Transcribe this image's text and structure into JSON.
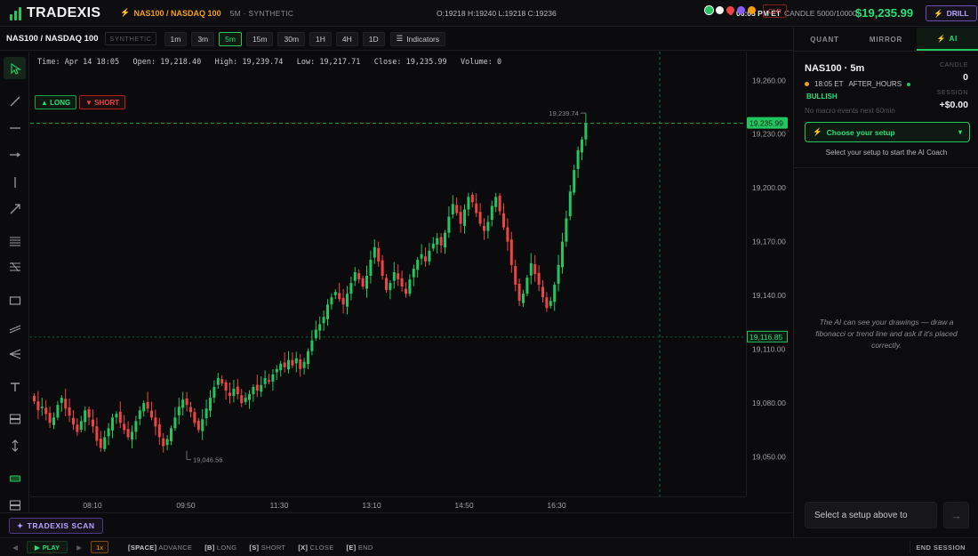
{
  "brand": {
    "name": "TRADEXIS",
    "color": "#22c55e"
  },
  "header": {
    "symbol_link": "NAS100 / NASDAQ 100",
    "mode": "5M · SYNTHETIC",
    "ohlc": "O:19218 H:19240 L:19218 C:19236",
    "clock": "06:05 PM ET",
    "candle_count": "CANDLE 5000/10000",
    "balance": "$19,235.99",
    "drill_label": "DRILL"
  },
  "toolbar": {
    "symbol": "NAS100 / NASDAQ 100",
    "badge": "SYNTHETIC",
    "timeframes": [
      "1m",
      "3m",
      "5m",
      "15m",
      "30m",
      "1H",
      "4H",
      "1D"
    ],
    "active_timeframe": "5m",
    "indicators_label": "Indicators",
    "colors": [
      "#22c55e",
      "#f5f5f5",
      "#ef4444",
      "#8b5cf6",
      "#f59e0b"
    ],
    "clear_label": "CLR"
  },
  "chart_info": {
    "time_label": "Time: Apr 14 18:05",
    "open_label": "Open: 19,218.40",
    "high_label": "High: 19,239.74",
    "low_label": "Low: 19,217.71",
    "close_label": "Close: 19,235.99",
    "volume_label": "Volume: 0"
  },
  "trade_buttons": {
    "long": "LONG",
    "short": "SHORT"
  },
  "chart_data": {
    "type": "candlestick",
    "y_ticks": [
      "19,260.00",
      "19,230.00",
      "19,200.00",
      "19,170.00",
      "19,140.00",
      "19,110.00",
      "19,080.00",
      "19,050.00"
    ],
    "y_tick_values": [
      19260,
      19230,
      19200,
      19170,
      19140,
      19110,
      19080,
      19050
    ],
    "ylim": [
      19028,
      19276
    ],
    "x_ticks": [
      "08:10",
      "09:50",
      "11:30",
      "13:10",
      "14:50",
      "16:30"
    ],
    "current_price_label": "19,235.99",
    "current_price": 19235.99,
    "crosshair_price_label": "19,116.85",
    "crosshair_price": 19116.85,
    "high_marker": "19,239.74",
    "high_value": 19239.74,
    "low_marker": "19,046.56",
    "low_value": 19046.56,
    "closes": [
      19081,
      19076,
      19078,
      19074,
      19069,
      19072,
      19079,
      19083,
      19077,
      19073,
      19068,
      19064,
      19070,
      19076,
      19072,
      19067,
      19059,
      19055,
      19061,
      19066,
      19072,
      19074,
      19069,
      19065,
      19061,
      19064,
      19070,
      19076,
      19080,
      19077,
      19072,
      19067,
      19061,
      19056,
      19060,
      19066,
      19072,
      19078,
      19082,
      19079,
      19075,
      19069,
      19065,
      19071,
      19077,
      19083,
      19089,
      19094,
      19091,
      19087,
      19084,
      19088,
      19085,
      19080,
      19083,
      19085,
      19089,
      19087,
      19090,
      19094,
      19092,
      19096,
      19099,
      19102,
      19100,
      19104,
      19101,
      19105,
      19099,
      19103,
      19109,
      19115,
      19121,
      19124,
      19128,
      19135,
      19139,
      19142,
      19138,
      19135,
      19141,
      19147,
      19153,
      19149,
      19145,
      19151,
      19160,
      19167,
      19159,
      19151,
      19143,
      19147,
      19153,
      19149,
      19145,
      19141,
      19149,
      19155,
      19160,
      19163,
      19159,
      19165,
      19169,
      19172,
      19168,
      19175,
      19184,
      19191,
      19186,
      19180,
      19188,
      19195,
      19192,
      19186,
      19180,
      19176,
      19181,
      19190,
      19195,
      19187,
      19178,
      19170,
      19157,
      19146,
      19137,
      19141,
      19150,
      19158,
      19152,
      19146,
      19139,
      19133,
      19137,
      19146,
      19157,
      19170,
      19183,
      19198,
      19210,
      19221,
      19227,
      19236
    ]
  },
  "tools": [
    "cursor-icon",
    "trendline-icon",
    "hline-icon",
    "ray-icon",
    "vline-icon",
    "arrow-line-icon",
    "fib-icon",
    "fib-ext-icon",
    "rectangle-icon",
    "channel-icon",
    "pitchfork-icon",
    "text-icon",
    "position-icon",
    "measure-icon",
    "long-position-icon",
    "short-position-icon"
  ],
  "scan": {
    "label": "TRADEXIS SCAN"
  },
  "bottom": {
    "play_label": "PLAY",
    "speed": "1x",
    "hint_space_key": "[SPACE]",
    "hint_space": "ADVANCE",
    "hint_long_key": "[B]",
    "hint_long": "LONG",
    "hint_short_key": "[S]",
    "hint_short": "SHORT",
    "hint_close_key": "[X]",
    "hint_close": "CLOSE",
    "hint_end_key": "[E]",
    "hint_end": "END",
    "end_session": "END SESSION"
  },
  "right_panel": {
    "tabs": [
      "QUANT",
      "MIRROR",
      "AI"
    ],
    "active_tab": "AI",
    "coach_title": "NAS100 · 5m",
    "time": "18:05 ET",
    "session_state": "AFTER_HOURS",
    "bias": "BULLISH",
    "macro_note": "No macro events next 60min",
    "candle_label": "CANDLE",
    "candle_value": "0",
    "session_label": "SESSION",
    "session_value": "+$0.00",
    "setup_button": "Choose your setup",
    "setup_hint": "Select your setup to start the AI Coach",
    "ai_message": "The AI can see your drawings — draw a fibonacci or trend line and ask if it's placed correctly.",
    "chat_placeholder": "Select a setup above to",
    "send_icon": "arrow-right-icon"
  }
}
